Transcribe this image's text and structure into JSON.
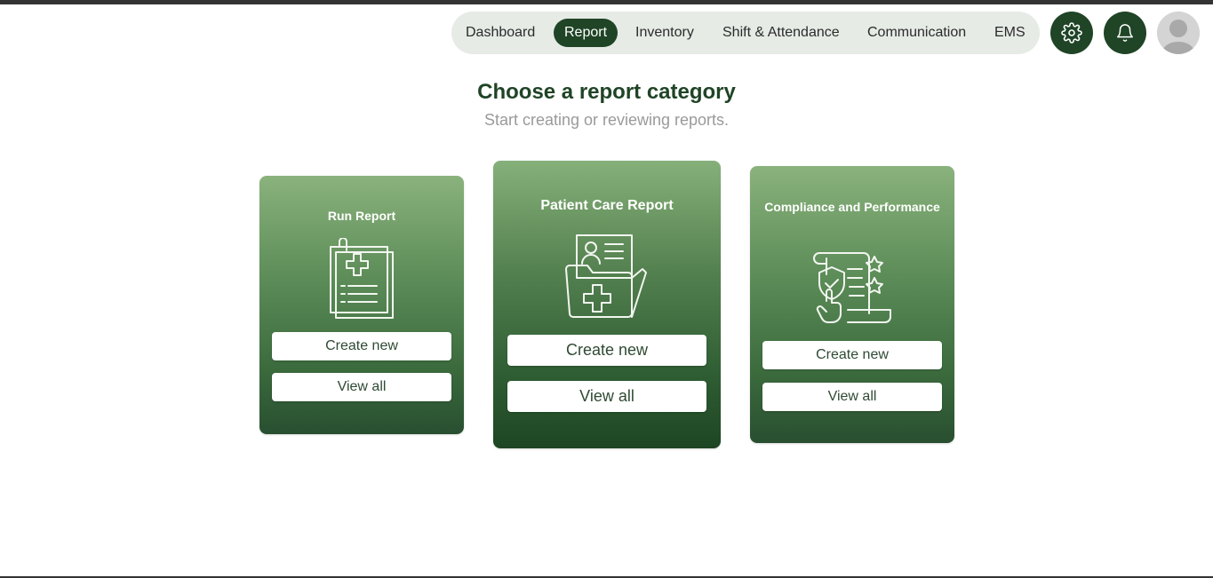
{
  "nav": {
    "items": [
      "Dashboard",
      "Report",
      "Inventory",
      "Shift & Attendance",
      "Communication",
      "EMS"
    ],
    "active": "Report"
  },
  "header": {
    "settings_icon": "gear-icon",
    "notifications_icon": "bell-icon",
    "avatar_icon": "user-avatar"
  },
  "page": {
    "title": "Choose a report category",
    "subtitle": "Start creating or reviewing reports."
  },
  "cards": [
    {
      "title": "Run Report",
      "icon": "clipboard-medical-icon",
      "create_label": "Create new",
      "view_label": "View all"
    },
    {
      "title": "Patient Care Report",
      "icon": "patient-folder-icon",
      "create_label": "Create new",
      "view_label": "View all"
    },
    {
      "title": "Compliance and Performance",
      "icon": "compliance-scroll-icon",
      "create_label": "Create new",
      "view_label": "View all"
    }
  ],
  "colors": {
    "brand_dark": "#1f4426",
    "card_top": "#8ab27c",
    "card_bottom": "#284f30",
    "nav_bg": "#e6ebe6"
  }
}
